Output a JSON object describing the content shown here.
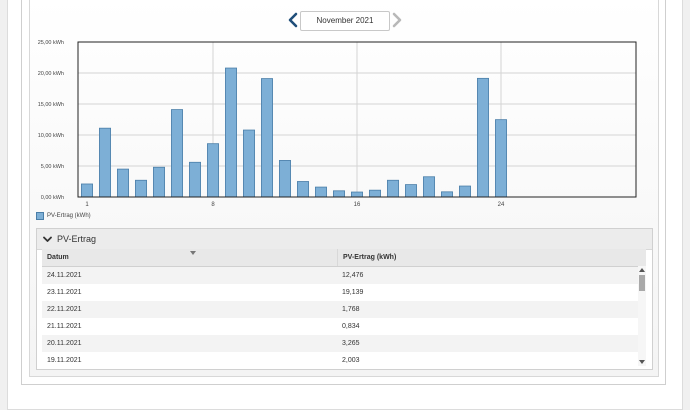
{
  "nav": {
    "month_label": "November 2021",
    "prev_icon": "chevron-left-icon",
    "next_icon": "chevron-right-icon"
  },
  "chart_data": {
    "type": "bar",
    "title": "",
    "xlabel": "",
    "ylabel": "",
    "x": [
      1,
      2,
      3,
      4,
      5,
      6,
      7,
      8,
      9,
      10,
      11,
      12,
      13,
      14,
      15,
      16,
      17,
      18,
      19,
      20,
      21,
      22,
      23,
      24
    ],
    "values": [
      2.1,
      11.1,
      4.5,
      2.7,
      4.8,
      14.1,
      5.6,
      8.6,
      20.8,
      10.8,
      19.1,
      5.9,
      2.5,
      1.6,
      1.0,
      0.8,
      1.1,
      2.7,
      2.0,
      3.265,
      0.834,
      1.768,
      19.139,
      12.476
    ],
    "ylim": [
      0,
      25
    ],
    "yticks": [
      0,
      5,
      10,
      15,
      20,
      25
    ],
    "ytick_labels": [
      "0,00 kWh",
      "5,00 kWh",
      "10,00 kWh",
      "15,00 kWh",
      "20,00 kWh",
      "25,00 kWh"
    ],
    "xlim": [
      1,
      31
    ],
    "xticks": [
      1,
      8,
      16,
      24
    ],
    "xtick_labels": [
      "1",
      "8",
      "16",
      "24"
    ],
    "grid": true,
    "legend": [
      {
        "name": "PV-Ertrag (kWh)",
        "color": "#7dafd6"
      }
    ],
    "legend_position": "bottom-left",
    "bar_color": "#7dafd6",
    "bar_border": "#4a7ea8"
  },
  "table": {
    "title": "PV-Ertrag",
    "toggle_icon": "chevron-down-icon",
    "columns": [
      "Datum",
      "PV-Ertrag (kWh)"
    ],
    "rows": [
      [
        "24.11.2021",
        "12,476"
      ],
      [
        "23.11.2021",
        "19,139"
      ],
      [
        "22.11.2021",
        "1,768"
      ],
      [
        "21.11.2021",
        "0,834"
      ],
      [
        "20.11.2021",
        "3,265"
      ],
      [
        "19.11.2021",
        "2,003"
      ]
    ]
  }
}
